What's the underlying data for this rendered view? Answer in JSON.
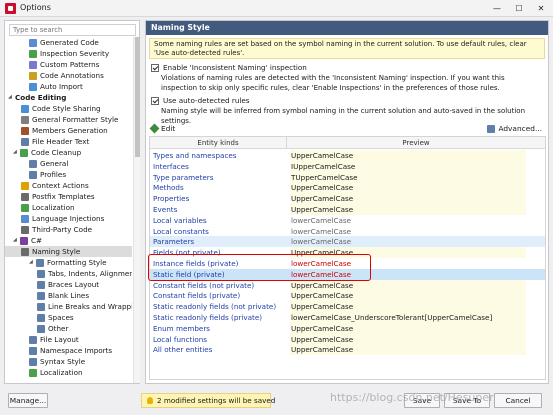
{
  "window": {
    "title": "Options"
  },
  "search": {
    "placeholder": "Type to search"
  },
  "tree": [
    {
      "label": "Generated Code",
      "color": "#5b8bd0"
    },
    {
      "label": "Inspection Severity",
      "color": "#4aa04a"
    },
    {
      "label": "Custom Patterns",
      "color": "#7a7acb"
    },
    {
      "label": "Code Annotations",
      "color": "#caa020"
    },
    {
      "label": "Auto Import",
      "color": "#4b8fd6"
    },
    {
      "label": "Code Editing",
      "color": "",
      "bold": true,
      "expand": "◢"
    },
    {
      "label": "Code Style Sharing",
      "color": "#4b8fd6"
    },
    {
      "label": "General Formatter Style",
      "color": "#7f7f7f"
    },
    {
      "label": "Members Generation",
      "color": "#a0522d"
    },
    {
      "label": "File Header Text",
      "color": "#5f7fa8"
    },
    {
      "label": "Code Cleanup",
      "color": "#4aa04a",
      "expand": "◢"
    },
    {
      "label": "General",
      "color": "#5f7fa8"
    },
    {
      "label": "Profiles",
      "color": "#5f7fa8"
    },
    {
      "label": "Context Actions",
      "color": "#e0a000"
    },
    {
      "label": "Postfix Templates",
      "color": "#6a6a6a"
    },
    {
      "label": "Localization",
      "color": "#4aa04a"
    },
    {
      "label": "Language Injections",
      "color": "#5b8bd0"
    },
    {
      "label": "Third-Party Code",
      "color": "#6a6a6a"
    },
    {
      "label": "C#",
      "color": "#7b3fa0",
      "expand": "◢"
    },
    {
      "label": "Naming Style",
      "color": "#6a6a6a",
      "selected": true
    },
    {
      "label": "Formatting Style",
      "color": "#5f7fa8",
      "expand": "◢"
    },
    {
      "label": "Tabs, Indents, Alignment",
      "color": "#5f7fa8"
    },
    {
      "label": "Braces Layout",
      "color": "#5f7fa8"
    },
    {
      "label": "Blank Lines",
      "color": "#5f7fa8"
    },
    {
      "label": "Line Breaks and Wrapping",
      "color": "#5f7fa8"
    },
    {
      "label": "Spaces",
      "color": "#5f7fa8"
    },
    {
      "label": "Other",
      "color": "#5f7fa8"
    },
    {
      "label": "File Layout",
      "color": "#5f7fa8"
    },
    {
      "label": "Namespace Imports",
      "color": "#5f7fa8"
    },
    {
      "label": "Syntax Style",
      "color": "#5f7fa8"
    },
    {
      "label": "Localization",
      "color": "#4aa04a"
    }
  ],
  "panel": {
    "header": "Naming Style",
    "info": "Some naming rules are set based on the symbol naming in the current solution. To use default rules, clear 'Use auto-detected rules'.",
    "checkbox1": {
      "label": "Enable 'Inconsistent Naming' inspection",
      "desc": "Violations of naming rules are detected with the 'Inconsistent Naming' inspection. If you want this inspection to skip only specific rules, clear 'Enable Inspections' in the preferences of those rules."
    },
    "checkbox2": {
      "label": "Use auto-detected rules",
      "desc": "Naming style will be inferred from symbol naming in the current solution and auto-saved in the solution settings."
    },
    "edit_label": "Edit",
    "advanced_label": "Advanced..."
  },
  "grid": {
    "col_kinds": "Entity kinds",
    "col_preview": "Preview",
    "rows": [
      {
        "kind": "Types and namespaces",
        "preview": "UpperCamelCase",
        "style": "upper"
      },
      {
        "kind": "Interfaces",
        "preview": "IUpperCamelCase",
        "style": "upper"
      },
      {
        "kind": "Type parameters",
        "preview": "TUpperCamelCase",
        "style": "upper"
      },
      {
        "kind": "Methods",
        "preview": "UpperCamelCase",
        "style": "upper"
      },
      {
        "kind": "Properties",
        "preview": "UpperCamelCase",
        "style": "upper"
      },
      {
        "kind": "Events",
        "preview": "UpperCamelCase",
        "style": "upper"
      },
      {
        "kind": "Local variables",
        "preview": "lowerCamelCase",
        "style": "lower"
      },
      {
        "kind": "Local constants",
        "preview": "lowerCamelCase",
        "style": "lower"
      },
      {
        "kind": "Parameters",
        "preview": "lowerCamelCase",
        "style": "lower",
        "row": "hl"
      },
      {
        "kind": "Fields (not private)",
        "preview": "UpperCamelCase",
        "style": "upper"
      },
      {
        "kind": "Instance fields (private)",
        "preview": "lowerCamelCase",
        "style": "red"
      },
      {
        "kind": "Static field (private)",
        "preview": "lowerCamelCase",
        "style": "red",
        "row": "sel"
      },
      {
        "kind": "Constant fields (not private)",
        "preview": "UpperCamelCase",
        "style": "upper"
      },
      {
        "kind": "Constant fields (private)",
        "preview": "UpperCamelCase",
        "style": "upper"
      },
      {
        "kind": "Static readonly fields (not private)",
        "preview": "UpperCamelCase",
        "style": "upper"
      },
      {
        "kind": "Static readonly fields (private)",
        "preview": "lowerCamelCase_UnderscoreTolerant[UpperCamelCase]",
        "style": "upper"
      },
      {
        "kind": "Enum members",
        "preview": "UpperCamelCase",
        "style": "upper"
      },
      {
        "kind": "Local functions",
        "preview": "UpperCamelCase",
        "style": "upper"
      },
      {
        "kind": "All other entities",
        "preview": "UpperCamelCase",
        "style": "upper"
      }
    ]
  },
  "footer": {
    "manage_label": "Manage...",
    "modified_text": "2 modified settings will be saved",
    "save_label": "Save",
    "save_to_label": "Save To",
    "cancel_label": "Cancel"
  },
  "watermark": "https://blog.csdn.net/Hesuper"
}
